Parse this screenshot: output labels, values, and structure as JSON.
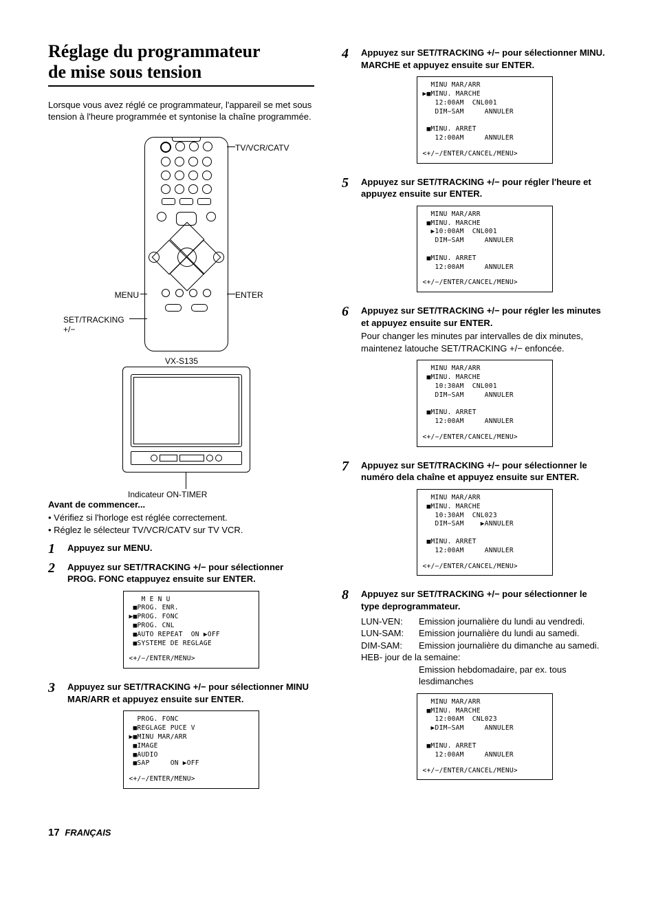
{
  "title_line1": "Réglage du programmateur",
  "title_line2": "de mise sous tension",
  "intro": "Lorsque vous avez réglé ce programmateur, l'appareil se met sous tension à l'heure programmée et syntonise la chaîne programmée.",
  "labels": {
    "tv_vcr_catv": "TV/VCR/CATV",
    "menu": "MENU",
    "enter": "ENTER",
    "set_tracking": "SET/TRACKING",
    "plus_minus": "+/−",
    "model": "VX-S135",
    "on_timer_indicator": "Indicateur ON-TIMER"
  },
  "before_heading": "Avant de commencer...",
  "before_bullets": [
    "Vérifiez si l'horloge est réglée correctement.",
    "Réglez le sélecteur TV/VCR/CATV sur TV VCR."
  ],
  "steps": {
    "s1": {
      "title": "Appuyez sur MENU."
    },
    "s2": {
      "title": "Appuyez sur SET/TRACKING +/− pour sélectionner PROG. FONC etappuyez ensuite sur ENTER.",
      "osd": "   M E N U\n ■PROG. ENR.\n▶■PROG. FONC\n ■PROG. CNL\n ■AUTO REPEAT  ON ▶OFF\n ■SYSTEME DE REGLAGE",
      "osd_nav": "<+/−/ENTER/MENU>"
    },
    "s3": {
      "title": "Appuyez sur SET/TRACKING +/− pour sélectionner MINU MAR/ARR et appuyez ensuite sur ENTER.",
      "osd": "  PROG. FONC\n ■REGLAGE PUCE V\n▶■MINU MAR/ARR\n ■IMAGE\n ■AUDIO\n ■SAP     ON ▶OFF",
      "osd_nav": "<+/−/ENTER/MENU>"
    },
    "s4": {
      "title": "Appuyez sur SET/TRACKING +/− pour sélectionner MINU. MARCHE et appuyez ensuite sur ENTER.",
      "osd": "  MINU MAR/ARR\n▶■MINU. MARCHE\n   12:00AM  CNL001\n   DIM−SAM     ANNULER\n\n ■MINU. ARRET\n   12:00AM     ANNULER",
      "osd_nav": "<+/−/ENTER/CANCEL/MENU>"
    },
    "s5": {
      "title": "Appuyez sur SET/TRACKING +/− pour régler l'heure et appuyez ensuite sur ENTER.",
      "osd": "  MINU MAR/ARR\n ■MINU. MARCHE\n  ▶10:00AM  CNL001\n   DIM−SAM     ANNULER\n\n ■MINU. ARRET\n   12:00AM     ANNULER",
      "osd_nav": "<+/−/ENTER/CANCEL/MENU>"
    },
    "s6": {
      "title": "Appuyez sur SET/TRACKING +/− pour régler les minutes et appuyez ensuite sur ENTER.",
      "sub": "Pour changer les minutes par intervalles de dix minutes, maintenez latouche SET/TRACKING +/− enfoncée.",
      "osd": "  MINU MAR/ARR\n ■MINU. MARCHE\n   10:30AM  CNL001\n   DIM−SAM     ANNULER\n\n ■MINU. ARRET\n   12:00AM     ANNULER",
      "osd_nav": "<+/−/ENTER/CANCEL/MENU>"
    },
    "s7": {
      "title": "Appuyez sur SET/TRACKING +/− pour sélectionner le numéro dela chaîne et appuyez ensuite sur ENTER.",
      "osd": "  MINU MAR/ARR\n ■MINU. MARCHE\n   10:30AM  CNL023\n   DIM−SAM    ▶ANNULER\n\n ■MINU. ARRET\n   12:00AM     ANNULER",
      "osd_nav": "<+/−/ENTER/CANCEL/MENU>"
    },
    "s8": {
      "title": "Appuyez sur SET/TRACKING +/− pour sélectionner le type deprogrammateur.",
      "defs": [
        {
          "term": "LUN-VEN:",
          "desc": "Emission journalière du lundi au vendredi."
        },
        {
          "term": "LUN-SAM:",
          "desc": "Emission journalière du lundi au samedi."
        },
        {
          "term": "DIM-SAM:",
          "desc": "Emission journalière du dimanche au samedi."
        }
      ],
      "heb_label": "HEB- jour de la semaine:",
      "heb_desc": "Emission hebdomadaire, par ex. tous lesdimanches",
      "osd": "  MINU MAR/ARR\n ■MINU. MARCHE\n   12:00AM  CNL023\n  ▶DIM−SAM     ANNULER\n\n ■MINU. ARRET\n   12:00AM     ANNULER",
      "osd_nav": "<+/−/ENTER/CANCEL/MENU>"
    }
  },
  "footer": {
    "page": "17",
    "lang": "FRANÇAIS"
  }
}
